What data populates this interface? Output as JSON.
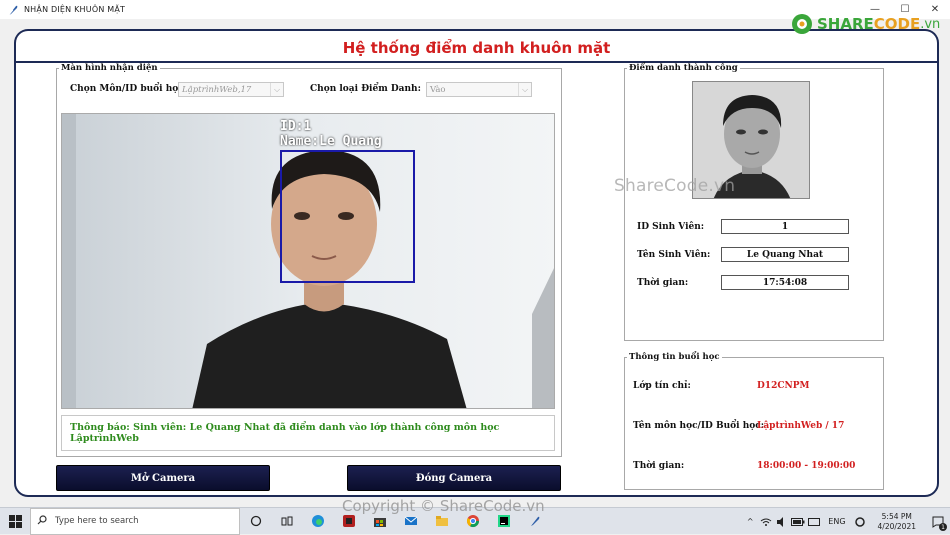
{
  "window": {
    "title": "NHẬN DIỆN KHUÔN MẶT",
    "minimize": "—",
    "maximize": "☐",
    "close": "✕"
  },
  "header": {
    "title": "Hệ thống điểm danh khuôn mặt"
  },
  "recognition": {
    "legend": "Màn hình nhận diện",
    "subject_label": "Chọn Môn/ID buổi học:",
    "subject_value": "LậptrìnhWeb,17",
    "type_label": "Chọn loại Điểm Danh:",
    "type_value": "Vào",
    "overlay_id": "ID:1",
    "overlay_name": "Name:Le Quang",
    "notice": "Thông báo: Sinh viên: Le Quang Nhat đã điểm danh vào lớp thành công môn học LậptrìnhWeb"
  },
  "buttons": {
    "open_camera": "Mở Camera",
    "close_camera": "Đóng Camera"
  },
  "success": {
    "legend": "Điểm danh thành công",
    "id_label": "ID Sinh Viên:",
    "id_value": "1",
    "name_label": "Tên Sinh Viên:",
    "name_value": "Le Quang Nhat",
    "time_label": "Thời gian:",
    "time_value": "17:54:08"
  },
  "session": {
    "legend": "Thông tin buổi học",
    "class_label": "Lớp tín chỉ:",
    "class_value": "D12CNPM",
    "subject_label": "Tên môn học/ID Buổi học:",
    "subject_value": "LậptrìnhWeb / 17",
    "time_label": "Thời gian:",
    "time_value": "18:00:00 - 19:00:00"
  },
  "watermarks": {
    "center": "ShareCode.vn",
    "bottom": "Copyright © ShareCode.vn",
    "logo_share": "SHARE",
    "logo_code": "CODE",
    "logo_tld": ".vn"
  },
  "taskbar": {
    "search_placeholder": "Type here to search",
    "language": "ENG",
    "time": "5:54 PM",
    "date": "4/20/2021",
    "notifications": "1"
  },
  "colors": {
    "header_red": "#d21f1f",
    "notice_green": "#2e8b1d",
    "button_navy": "#0f1238",
    "face_box": "#1a1aa8"
  }
}
